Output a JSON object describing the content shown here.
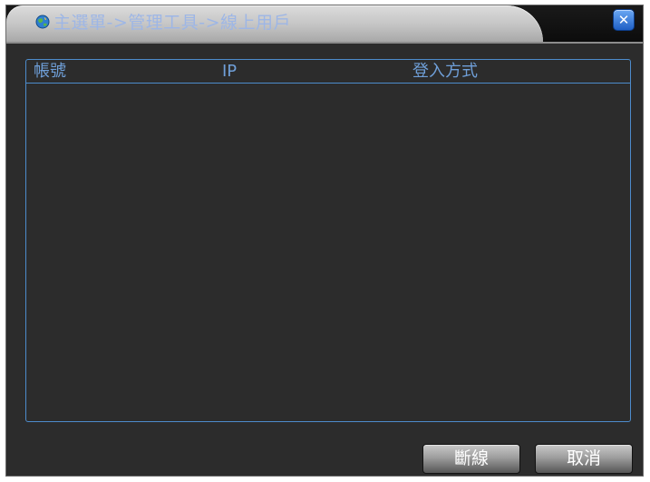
{
  "window": {
    "title": "主選單->管理工具->線上用戶",
    "title_icon": "globe-icon",
    "close_label": "✕"
  },
  "table": {
    "columns": [
      "帳號",
      "IP",
      "登入方式"
    ],
    "rows": []
  },
  "buttons": {
    "disconnect_label": "斷線",
    "cancel_label": "取消"
  },
  "colors": {
    "background": "#2c2c2c",
    "accent": "#4d8ccc",
    "header_text": "#6f9fd8",
    "title_text": "#9db6e6",
    "close_button": "#2f72d6"
  }
}
